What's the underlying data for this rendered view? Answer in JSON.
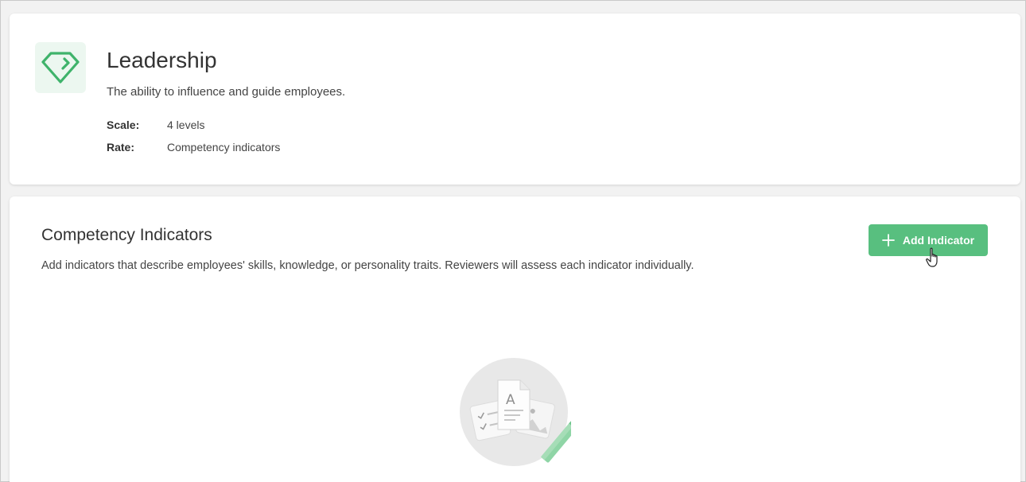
{
  "competency": {
    "icon": "diamond-icon",
    "title": "Leadership",
    "description": "The ability to influence and guide employees.",
    "scale_label": "Scale:",
    "scale_value": "4 levels",
    "rate_label": "Rate:",
    "rate_value": "Competency indicators"
  },
  "indicators": {
    "title": "Competency Indicators",
    "description": "Add indicators that describe employees' skills, knowledge, or personality traits. Reviewers will assess each indicator individually.",
    "add_button_label": "Add Indicator",
    "add_button_icon": "plus-icon",
    "empty_illustration": "empty-documents-illustration"
  },
  "colors": {
    "accent": "#58bf7f",
    "icon_bg": "#ecf7f0"
  }
}
